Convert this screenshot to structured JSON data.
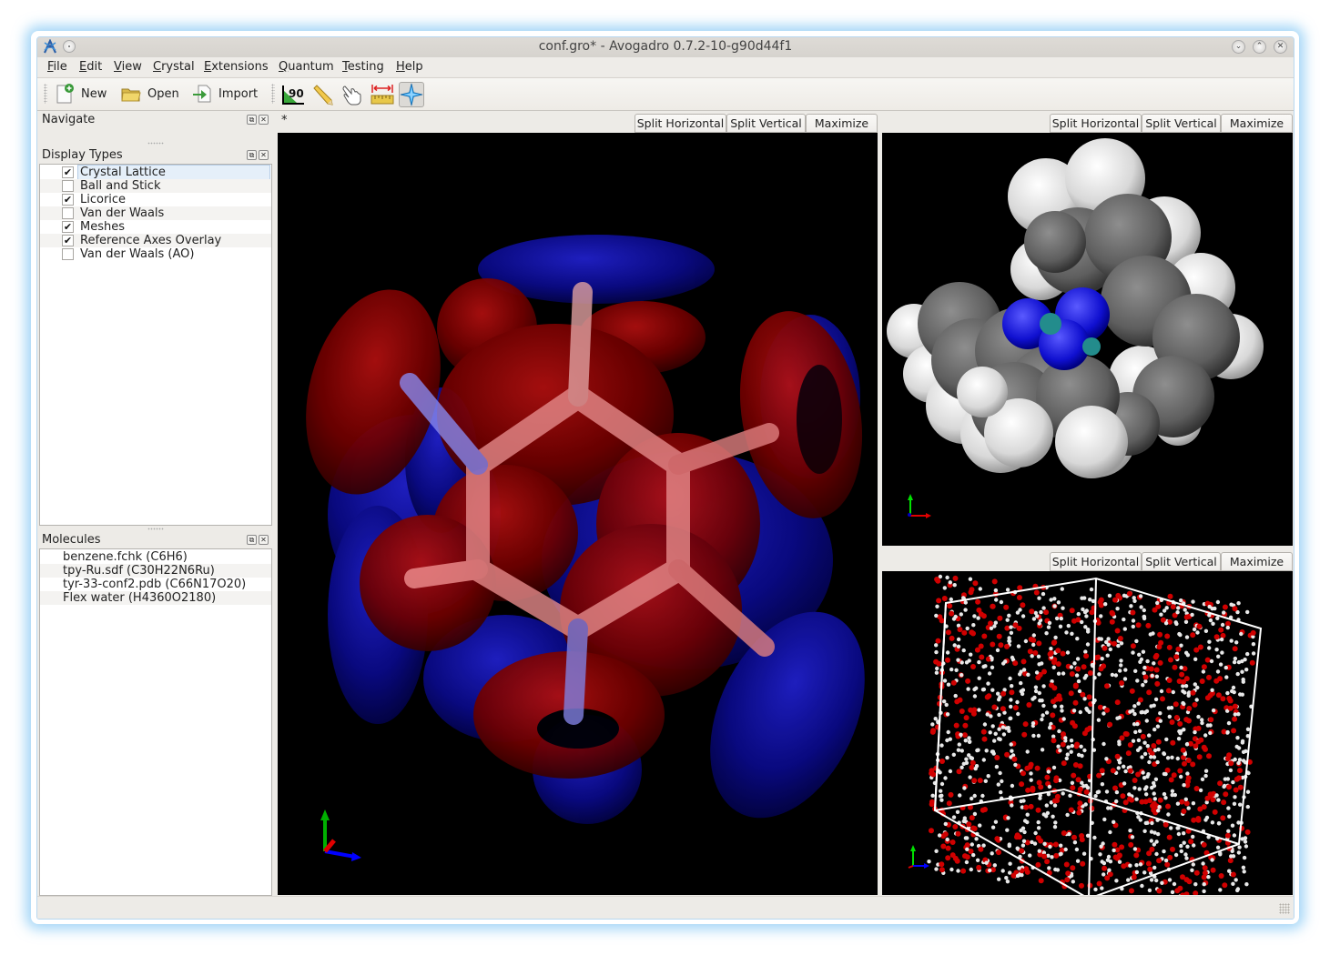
{
  "window": {
    "title": "conf.gro* - Avogadro 0.7.2-10-g90d44f1",
    "controls": [
      "minimize",
      "maximize",
      "close"
    ]
  },
  "menubar": {
    "items": [
      {
        "label": "File",
        "mnemonic": "F"
      },
      {
        "label": "Edit",
        "mnemonic": "E"
      },
      {
        "label": "View",
        "mnemonic": "V"
      },
      {
        "label": "Crystal",
        "mnemonic": "C"
      },
      {
        "label": "Extensions",
        "mnemonic": "E"
      },
      {
        "label": "Quantum",
        "mnemonic": "Q"
      },
      {
        "label": "Testing",
        "mnemonic": "T"
      },
      {
        "label": "Help",
        "mnemonic": "H"
      }
    ]
  },
  "toolbar": {
    "file_actions": [
      {
        "label": "New",
        "icon": "new-document-icon"
      },
      {
        "label": "Open",
        "icon": "open-folder-icon"
      },
      {
        "label": "Import",
        "icon": "import-icon"
      }
    ],
    "tools": [
      {
        "name": "bond-centric-manipulate",
        "icon": "angle-90-icon",
        "glyph": "90",
        "active": false
      },
      {
        "name": "draw",
        "icon": "pencil-icon",
        "active": false
      },
      {
        "name": "manipulate",
        "icon": "hand-pointer-icon",
        "active": false
      },
      {
        "name": "measure",
        "icon": "ruler-measure-icon",
        "active": false
      },
      {
        "name": "navigate",
        "icon": "navigate-star-icon",
        "active": true
      }
    ]
  },
  "docks": {
    "navigate": {
      "title": "Navigate"
    },
    "display_types": {
      "title": "Display Types",
      "items": [
        {
          "label": "Crystal Lattice",
          "checked": true,
          "selected": true
        },
        {
          "label": "Ball and Stick",
          "checked": false,
          "selected": false
        },
        {
          "label": "Licorice",
          "checked": true,
          "selected": false
        },
        {
          "label": "Van der Waals",
          "checked": false,
          "selected": false
        },
        {
          "label": "Meshes",
          "checked": true,
          "selected": false
        },
        {
          "label": "Reference Axes Overlay",
          "checked": true,
          "selected": false
        },
        {
          "label": "Van der Waals (AO)",
          "checked": false,
          "selected": false
        }
      ]
    },
    "molecules": {
      "title": "Molecules",
      "items": [
        {
          "label": "benzene.fchk (C6H6)"
        },
        {
          "label": "tpy-Ru.sdf (C30H22N6Ru)"
        },
        {
          "label": "tyr-33-conf2.pdb (C66N17O20)"
        },
        {
          "label": "Flex water (H4360O2180)"
        }
      ]
    }
  },
  "views": {
    "tab_marker": "*",
    "buttons": {
      "split_h": "Split Horizontal",
      "split_v": "Split Vertical",
      "maximize": "Maximize"
    },
    "panels": [
      {
        "name": "benzene-orbital-view",
        "molecule": "benzene.fchk",
        "render": "licorice + orbital meshes"
      },
      {
        "name": "tpy-ru-view",
        "molecule": "tpy-Ru.sdf",
        "render": "van der waals"
      },
      {
        "name": "water-box-view",
        "molecule": "Flex water",
        "render": "ball and stick + crystal lattice"
      }
    ]
  },
  "colors": {
    "orbital_positive": "#7a0000",
    "orbital_negative": "#0a0a8a",
    "axis_x": "#ff0000",
    "axis_y": "#00c000",
    "axis_z": "#0000ff",
    "oxygen": "#d00000",
    "hydrogen": "#e8e8e8",
    "carbon": "#6a6a6a",
    "nitrogen": "#1a1ae0",
    "ruthenium": "#238c8c"
  }
}
